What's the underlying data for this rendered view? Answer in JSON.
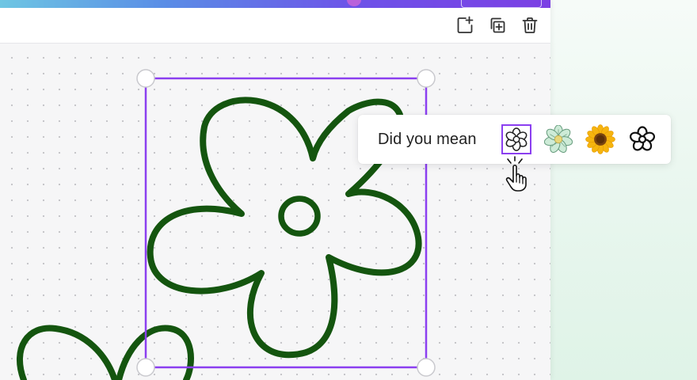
{
  "toolbar": {
    "buttons": [
      {
        "name": "add-page-button",
        "icon": "add-page-icon"
      },
      {
        "name": "duplicate-button",
        "icon": "duplicate-icon"
      },
      {
        "name": "delete-button",
        "icon": "trash-icon"
      }
    ]
  },
  "suggestions": {
    "label": "Did you mean",
    "options": [
      {
        "name": "suggestion-flower-outline",
        "icon": "flower-outline-icon",
        "selected": true
      },
      {
        "name": "suggestion-green-flower",
        "icon": "green-flower-icon",
        "selected": false
      },
      {
        "name": "suggestion-sunflower",
        "icon": "sunflower-icon",
        "selected": false
      },
      {
        "name": "suggestion-flower-bold",
        "icon": "flower-bold-icon",
        "selected": false
      }
    ]
  },
  "colors": {
    "accent": "#8b3ff0",
    "drawing": "#14550f",
    "handle_border": "#c9c9ce"
  }
}
